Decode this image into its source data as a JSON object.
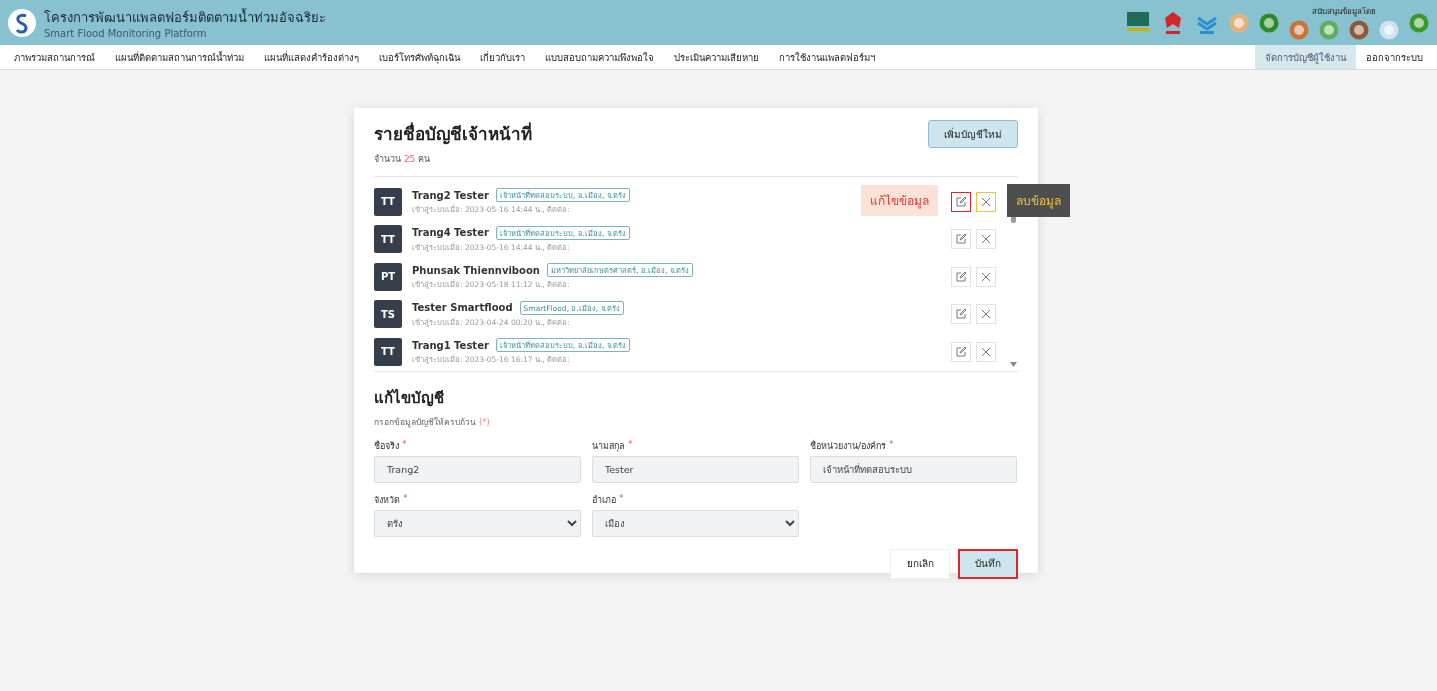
{
  "header": {
    "title": "โครงการพัฒนาแพลตฟอร์มติดตามน้ำท่วมอัจฉริยะ",
    "subtitle": "Smart Flood Monitoring Platform",
    "sponsor_label": "สนับสนุนข้อมูลโดย"
  },
  "nav": {
    "left": [
      {
        "label": "ภาพรวมสถานการณ์",
        "selected": false
      },
      {
        "label": "แผนที่ติดตามสถานการณ์น้ำท่วม",
        "selected": false
      },
      {
        "label": "แผนที่แสดงคำร้องต่างๆ",
        "selected": false
      },
      {
        "label": "เบอร์โทรศัพท์ฉุกเฉิน",
        "selected": false
      },
      {
        "label": "เกี่ยวกับเรา",
        "selected": false
      },
      {
        "label": "แบบสอบถามความพึงพอใจ",
        "selected": false
      },
      {
        "label": "ประเมินความเสียหาย",
        "selected": false
      },
      {
        "label": "การใช้งานแพลตฟอร์มฯ",
        "selected": false
      }
    ],
    "right": [
      {
        "label": "จัดการบัญชีผู้ใช้งาน",
        "selected": true
      },
      {
        "label": "ออกจากระบบ",
        "selected": false
      }
    ]
  },
  "panel": {
    "title": "รายชื่อบัญชีเจ้าหน้าที่",
    "count_prefix": "จำนวน",
    "count": "25",
    "count_suffix": "คน",
    "add_button": "เพิ่มบัญชีใหม่"
  },
  "accounts": [
    {
      "initials": "TT",
      "name": "Trang2 Tester",
      "tag": "เจ้าหน้าที่ทดสอบระบบ, อ.เมือง, จ.ตรัง",
      "login": "เข้าสู่ระบบเมื่อ: 2023-05-16 14:44 น., ติดต่อ:",
      "edit_highlighted": true,
      "delete_highlighted": true,
      "edit_tooltip": "แก้ไขข้อมูล",
      "delete_tooltip": "ลบข้อมูล"
    },
    {
      "initials": "TT",
      "name": "Trang4 Tester",
      "tag": "เจ้าหน้าที่ทดสอบระบบ, อ.เมือง, จ.ตรัง",
      "login": "เข้าสู่ระบบเมื่อ: 2023-05-16 14:44 น., ติดต่อ:",
      "edit_highlighted": false,
      "delete_highlighted": false
    },
    {
      "initials": "PT",
      "name": "Phunsak Thiennviboon",
      "tag": "มหาวิทยาลัยเกษตรศาสตร์, อ.เมือง, จ.ตรัง",
      "login": "เข้าสู่ระบบเมื่อ: 2023-05-18 11:12 น., ติดต่อ:",
      "edit_highlighted": false,
      "delete_highlighted": false
    },
    {
      "initials": "TS",
      "name": "Tester Smartflood",
      "tag": "SmartFlood, อ.เมือง, จ.ตรัง",
      "login": "เข้าสู่ระบบเมื่อ: 2023-04-24 00:20 น., ติดต่อ:",
      "edit_highlighted": false,
      "delete_highlighted": false
    },
    {
      "initials": "TT",
      "name": "Trang1 Tester",
      "tag": "เจ้าหน้าที่ทดสอบระบบ, อ.เมือง, จ.ตรัง",
      "login": "เข้าสู่ระบบเมื่อ: 2023-05-16 16:17 น., ติดต่อ:",
      "edit_highlighted": false,
      "delete_highlighted": false
    }
  ],
  "form": {
    "title": "แก้ไขบัญชี",
    "hint": "กรอกข้อมูลบัญชีให้ครบถ้วน",
    "hint_mark": "(*)",
    "fields": [
      {
        "label": "ชื่อจริง",
        "required_mark": "*",
        "value": "Trang2",
        "kind": "text"
      },
      {
        "label": "นามสกุล",
        "required_mark": "*",
        "value": "Tester",
        "kind": "text"
      },
      {
        "label": "ชื่อหน่วยงาน/องค์กร",
        "required_mark": "*",
        "value": "เจ้าหน้าที่ทดสอบระบบ",
        "kind": "text"
      },
      {
        "label": "จังหวัด",
        "required_mark": "*",
        "value": "ตรัง",
        "kind": "select"
      },
      {
        "label": "อำเภอ",
        "required_mark": "*",
        "value": "เมือง",
        "kind": "select"
      }
    ],
    "cancel": "ยกเลิก",
    "save": "บันทึก",
    "save_highlighted": true
  }
}
